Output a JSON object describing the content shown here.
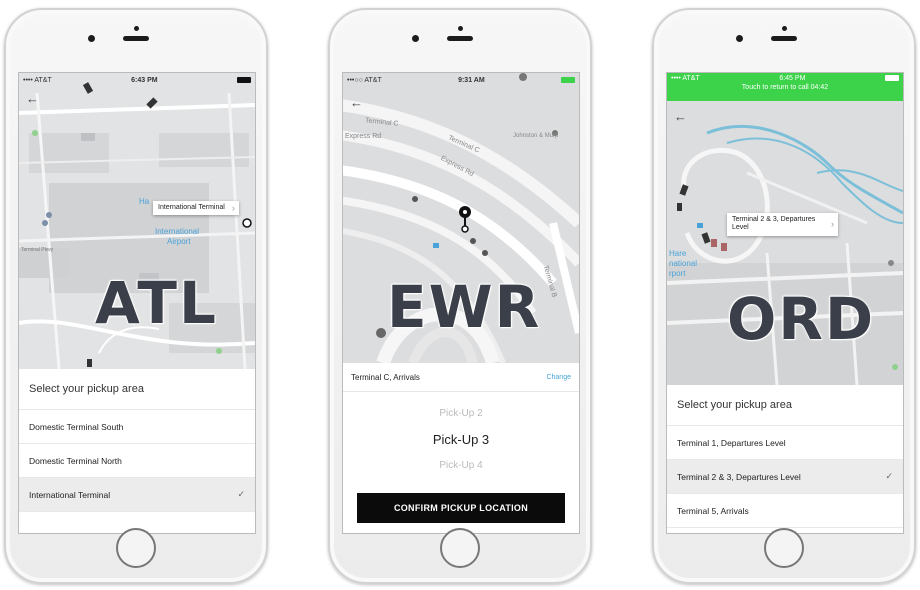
{
  "phones": {
    "atl": {
      "status_carrier": "•••• AT&T",
      "status_time": "6:43 PM",
      "map_label_1": "Ha",
      "map_label_2": "International",
      "map_label_3": "Airport",
      "map_label_4": "Terminal Pkwy",
      "bubble_text": "International Terminal",
      "airport_code": "ATL",
      "sheet_title": "Select your pickup area",
      "options": [
        "Domestic Terminal South",
        "Domestic Terminal North",
        "International Terminal"
      ],
      "selected_index": 2
    },
    "ewr": {
      "status_carrier": "•••○○ AT&T",
      "status_time": "9:31 AM",
      "map_label_1": "Terminal C",
      "map_label_2": "Express Rd",
      "map_label_3": "Express Rd",
      "map_label_4": "Terminal C",
      "map_label_5": "Johnston & Murp",
      "map_label_6": "Terminal B",
      "airport_code": "EWR",
      "location_label": "Terminal C, Arrivals",
      "change_label": "Change",
      "picker_prev": "Pick-Up 2",
      "picker_current": "Pick-Up 3",
      "picker_next": "Pick-Up 4",
      "confirm_label": "CONFIRM PICKUP LOCATION"
    },
    "ord": {
      "status_carrier": "•••• AT&T",
      "status_time": "6:45 PM",
      "banner_text": "Touch to return to call 04:42",
      "map_label_1": "Hare",
      "map_label_2": "national",
      "map_label_3": "rport",
      "bubble_text": "Terminal 2 & 3, Departures Level",
      "airport_code": "ORD",
      "sheet_title": "Select your pickup area",
      "options": [
        "Terminal 1, Departures Level",
        "Terminal 2 & 3, Departures Level",
        "Terminal 5, Arrivals"
      ],
      "selected_index": 1
    }
  },
  "icons": {
    "back": "arrow-left-icon",
    "check": "checkmark-icon",
    "chevron": "chevron-right-icon"
  },
  "colors": {
    "call_banner": "#3cd34a",
    "confirm_button": "#0b0b0b",
    "map_water": "#7bbfd9",
    "map_link_blue": "#4aa3d8"
  }
}
